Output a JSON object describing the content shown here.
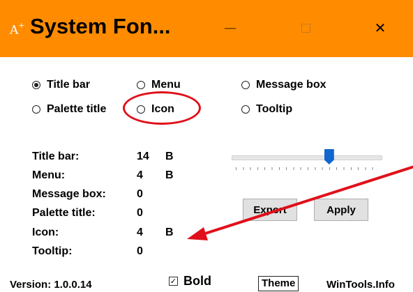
{
  "window": {
    "icon_glyph": "A",
    "icon_sup": "+",
    "title": "System Fon...",
    "minimize_glyph": "—",
    "close_glyph": "✕"
  },
  "options": {
    "title_bar": "Title bar",
    "menu": "Menu",
    "message_box": "Message box",
    "palette_title": "Palette title",
    "icon": "Icon",
    "tooltip": "Tooltip",
    "selected": "Title bar"
  },
  "info": [
    {
      "label": "Title bar:",
      "value": "14",
      "flag": "B"
    },
    {
      "label": "Menu:",
      "value": "4",
      "flag": "B"
    },
    {
      "label": "Message box:",
      "value": "0",
      "flag": ""
    },
    {
      "label": "Palette title:",
      "value": "0",
      "flag": ""
    },
    {
      "label": "Icon:",
      "value": "4",
      "flag": "B"
    },
    {
      "label": "Tooltip:",
      "value": "0",
      "flag": ""
    }
  ],
  "slider": {
    "level": 0.7
  },
  "buttons": {
    "export": "Export",
    "apply": "Apply",
    "theme": "Theme"
  },
  "footer": {
    "version": "Version: 1.0.0.14",
    "bold_label": "Bold",
    "bold_checked": true,
    "bold_check_glyph": "✓",
    "site": "WinTools.Info"
  },
  "colors": {
    "titlebar": "#ff8c00",
    "annotation_red": "#e0101a",
    "slider_thumb": "#1065d0"
  }
}
